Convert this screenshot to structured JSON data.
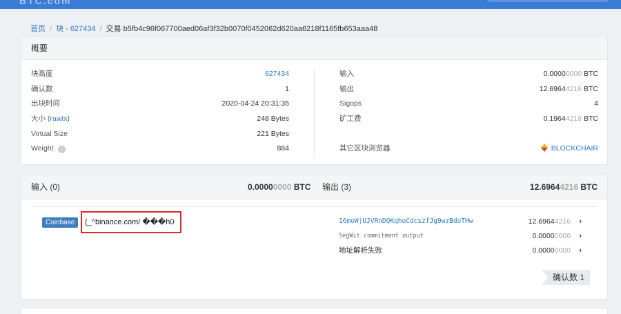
{
  "header": {
    "logo_fragment": "BTC.com"
  },
  "breadcrumb": {
    "home": "首页",
    "block": "块 - 627434",
    "tx": "交易 b5fb4c96f067700aed06af3f32b0070f0452062d620aa6218f1165fb653aaa48"
  },
  "overview": {
    "title": "概要",
    "left": [
      {
        "k": "块高度",
        "v": "627434"
      },
      {
        "k": "确认数",
        "v": "1"
      },
      {
        "k": "出块时间",
        "v": "2020-04-24 20:31:35"
      },
      {
        "k": "大小",
        "k_link": "rawtx",
        "v": "248 Bytes"
      },
      {
        "k": "Virtual Size",
        "v": "221 Bytes"
      },
      {
        "k": "Weight",
        "v": "884"
      }
    ],
    "right": [
      {
        "k": "输入",
        "v_main": "0.0000",
        "v_dim": "0000",
        "v_unit": " BTC"
      },
      {
        "k": "输出",
        "v_main": "12.6964",
        "v_dim": "4216",
        "v_unit": " BTC"
      },
      {
        "k": "Sigops",
        "v": "4"
      },
      {
        "k": "矿工费",
        "v_main": "0.1964",
        "v_dim": "4216",
        "v_unit": " BTC"
      },
      {
        "k": "其它区块浏览器",
        "v": "BLOCKCHAIR"
      }
    ],
    "weight_info_icon": "info-icon",
    "explorer_icon": "blockchair-logo-icon"
  },
  "tx": {
    "inputs_label": "输入 (0)",
    "inputs_amount_main": "0.0000",
    "inputs_amount_dim": "0000",
    "inputs_unit": " BTC",
    "outputs_label": "输出 (3)",
    "outputs_amount_main": "12.6964",
    "outputs_amount_dim": "4216",
    "outputs_unit": " BTC",
    "coinbase_label": "Coinbase",
    "coinbase_script": "(_^binance.com/  ���h0",
    "outputs": [
      {
        "addr": "16moWjUJVRnDQKqhoCdcszfJg9wzBdoTHw",
        "amt_main": "12.6964",
        "amt_dim": "4216"
      },
      {
        "addr": "SegWit commitment output",
        "amt_main": "0.0000",
        "amt_dim": "0000"
      },
      {
        "addr": "地址解析失败",
        "amt_main": "0.0000",
        "amt_dim": "0000"
      }
    ],
    "confirmations": "确认数 1"
  },
  "colors": {
    "accent": "#2b7bc6",
    "highlight_box": "#e0262a",
    "coinbase_bg": "#3e7ebd"
  }
}
